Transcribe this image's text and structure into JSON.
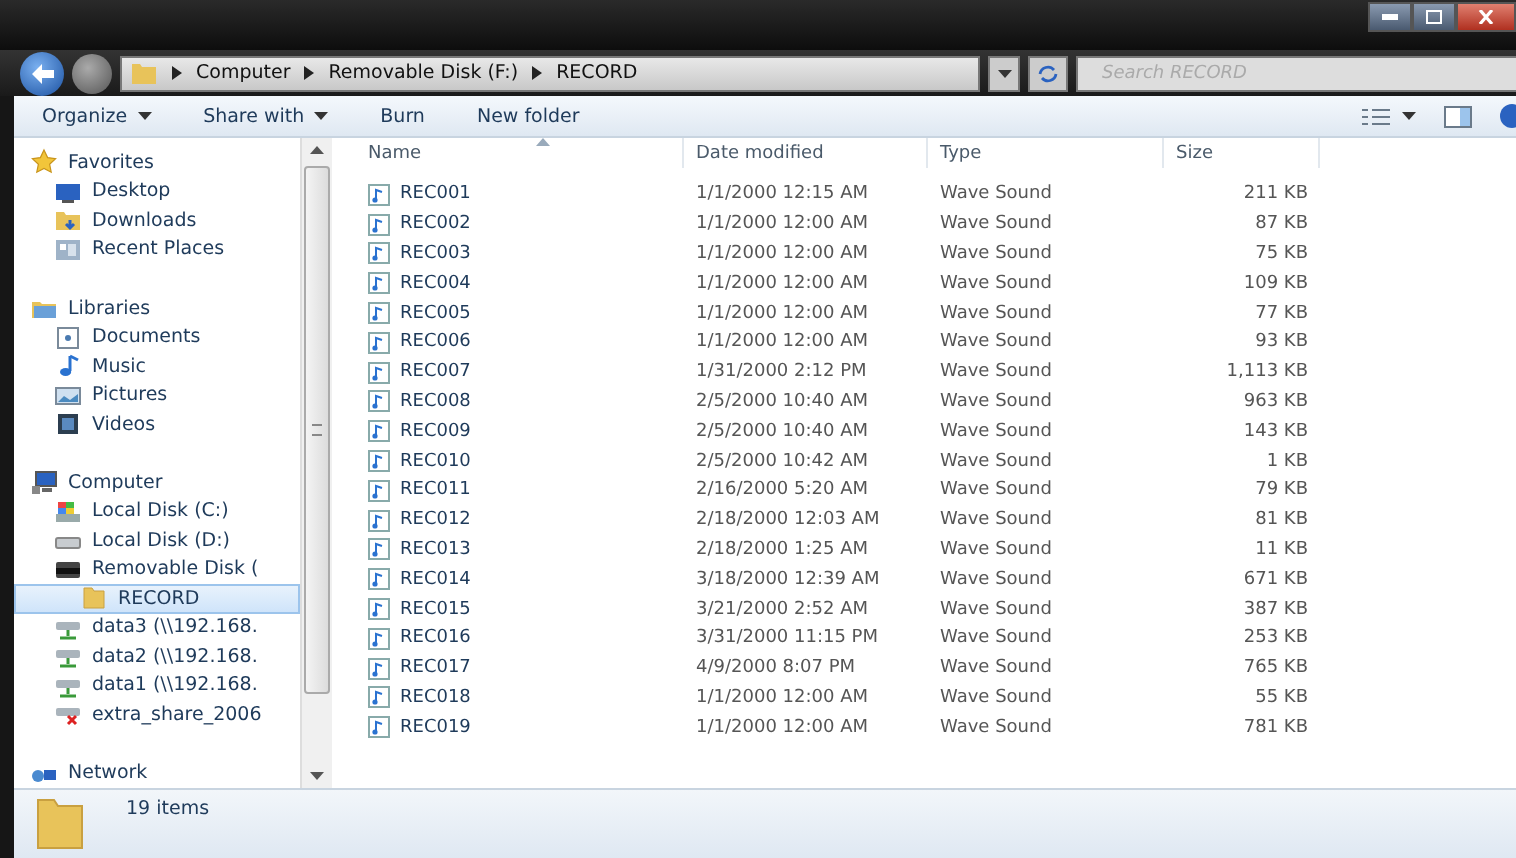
{
  "address_bar": {
    "path": [
      "Computer",
      "Removable Disk (F:)",
      "RECORD"
    ],
    "search_placeholder": "Search RECORD"
  },
  "toolbar": {
    "buttons": [
      {
        "label": "Organize",
        "dropdown": true
      },
      {
        "label": "Share with",
        "dropdown": true
      },
      {
        "label": "Burn",
        "dropdown": false
      },
      {
        "label": "New folder",
        "dropdown": false
      }
    ]
  },
  "sidebar": {
    "items": [
      {
        "label": "Favorites",
        "kind": "star",
        "selected": false,
        "children": [
          {
            "label": "Desktop",
            "kind": "desktop",
            "selected": false
          },
          {
            "label": "Downloads",
            "kind": "downloads",
            "selected": false
          },
          {
            "label": "Recent Places",
            "kind": "recent",
            "selected": false
          }
        ]
      },
      {
        "label": "Libraries",
        "kind": "library",
        "selected": false,
        "children": [
          {
            "label": "Documents",
            "kind": "documents",
            "selected": false
          },
          {
            "label": "Music",
            "kind": "music",
            "selected": false
          },
          {
            "label": "Pictures",
            "kind": "pictures",
            "selected": false
          },
          {
            "label": "Videos",
            "kind": "videos",
            "selected": false
          }
        ]
      },
      {
        "label": "Computer",
        "kind": "computer",
        "selected": false,
        "children": [
          {
            "label": "Local Disk (C:)",
            "kind": "system",
            "selected": false
          },
          {
            "label": "Local Disk (D:)",
            "kind": "disk",
            "selected": false
          },
          {
            "label": "Removable Disk (",
            "kind": "removable",
            "selected": false,
            "children": [
              {
                "label": "RECORD",
                "kind": "folder",
                "selected": true
              }
            ]
          },
          {
            "label": "data3 (\\\\192.168.",
            "kind": "share",
            "selected": false
          },
          {
            "label": "data2 (\\\\192.168.",
            "kind": "share",
            "selected": false
          },
          {
            "label": "data1 (\\\\192.168.",
            "kind": "share",
            "selected": false
          },
          {
            "label": "extra_share_2006",
            "kind": "offline",
            "selected": false
          }
        ]
      },
      {
        "label": "Network",
        "kind": "network",
        "selected": false
      }
    ]
  },
  "table": {
    "columns": [
      "Name",
      "Date modified",
      "Type",
      "Size"
    ],
    "rows": [
      [
        "REC001",
        "1/1/2000 12:15 AM",
        "Wave Sound",
        "211 KB"
      ],
      [
        "REC002",
        "1/1/2000 12:00 AM",
        "Wave Sound",
        "87 KB"
      ],
      [
        "REC003",
        "1/1/2000 12:00 AM",
        "Wave Sound",
        "75 KB"
      ],
      [
        "REC004",
        "1/1/2000 12:00 AM",
        "Wave Sound",
        "109 KB"
      ],
      [
        "REC005",
        "1/1/2000 12:00 AM",
        "Wave Sound",
        "77 KB"
      ],
      [
        "REC006",
        "1/1/2000 12:00 AM",
        "Wave Sound",
        "93 KB"
      ],
      [
        "REC007",
        "1/31/2000 2:12 PM",
        "Wave Sound",
        "1,113 KB"
      ],
      [
        "REC008",
        "2/5/2000 10:40 AM",
        "Wave Sound",
        "963 KB"
      ],
      [
        "REC009",
        "2/5/2000 10:40 AM",
        "Wave Sound",
        "143 KB"
      ],
      [
        "REC010",
        "2/5/2000 10:42 AM",
        "Wave Sound",
        "1 KB"
      ],
      [
        "REC011",
        "2/16/2000 5:20 AM",
        "Wave Sound",
        "79 KB"
      ],
      [
        "REC012",
        "2/18/2000 12:03 AM",
        "Wave Sound",
        "81 KB"
      ],
      [
        "REC013",
        "2/18/2000 1:25 AM",
        "Wave Sound",
        "11 KB"
      ],
      [
        "REC014",
        "3/18/2000 12:39 AM",
        "Wave Sound",
        "671 KB"
      ],
      [
        "REC015",
        "3/21/2000 2:52 AM",
        "Wave Sound",
        "387 KB"
      ],
      [
        "REC016",
        "3/31/2000 11:15 PM",
        "Wave Sound",
        "253 KB"
      ],
      [
        "REC017",
        "4/9/2000 8:07 PM",
        "Wave Sound",
        "765 KB"
      ],
      [
        "REC018",
        "1/1/2000 12:00 AM",
        "Wave Sound",
        "55 KB"
      ],
      [
        "REC019",
        "1/1/2000 12:00 AM",
        "Wave Sound",
        "781 KB"
      ]
    ]
  },
  "status_bar": {
    "item_count": "19 items"
  }
}
